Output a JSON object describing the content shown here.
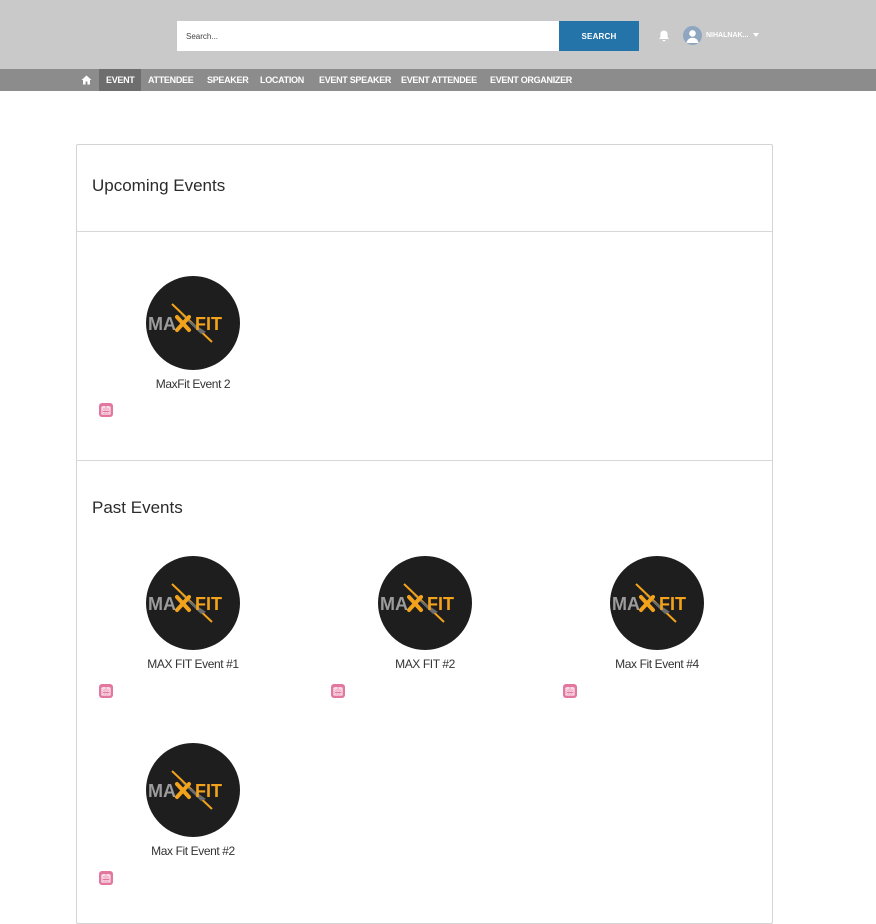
{
  "header": {
    "search_placeholder": "Search...",
    "search_button": "SEARCH",
    "username": "NIHALNAK..."
  },
  "nav": {
    "items": [
      {
        "label": "EVENT",
        "active": true
      },
      {
        "label": "ATTENDEE"
      },
      {
        "label": "SPEAKER"
      },
      {
        "label": "LOCATION"
      },
      {
        "label": "EVENT SPEAKER"
      },
      {
        "label": "EVENT ATTENDEE"
      },
      {
        "label": "EVENT ORGANIZER"
      }
    ]
  },
  "upcoming": {
    "title": "Upcoming Events",
    "events": [
      {
        "name": "MaxFit Event 2",
        "logo_text_left": "MA",
        "logo_text_right": "FIT"
      }
    ]
  },
  "past": {
    "title": "Past Events",
    "events": [
      {
        "name": "MAX FIT Event #1",
        "logo_text_left": "MA",
        "logo_text_right": "FIT"
      },
      {
        "name": "MAX FIT #2",
        "logo_text_left": "MA",
        "logo_text_right": "FIT"
      },
      {
        "name": "Max Fit Event #4",
        "logo_text_left": "MA",
        "logo_text_right": "FIT"
      },
      {
        "name": "Max Fit Event #2",
        "logo_text_left": "MA",
        "logo_text_right": "FIT"
      }
    ]
  },
  "colors": {
    "topbar": "#c9c9c9",
    "navbar": "#8c8c8c",
    "search_button": "#2574a9",
    "calendar_icon": "#e3769f",
    "logo_orange": "#f2a31b"
  }
}
